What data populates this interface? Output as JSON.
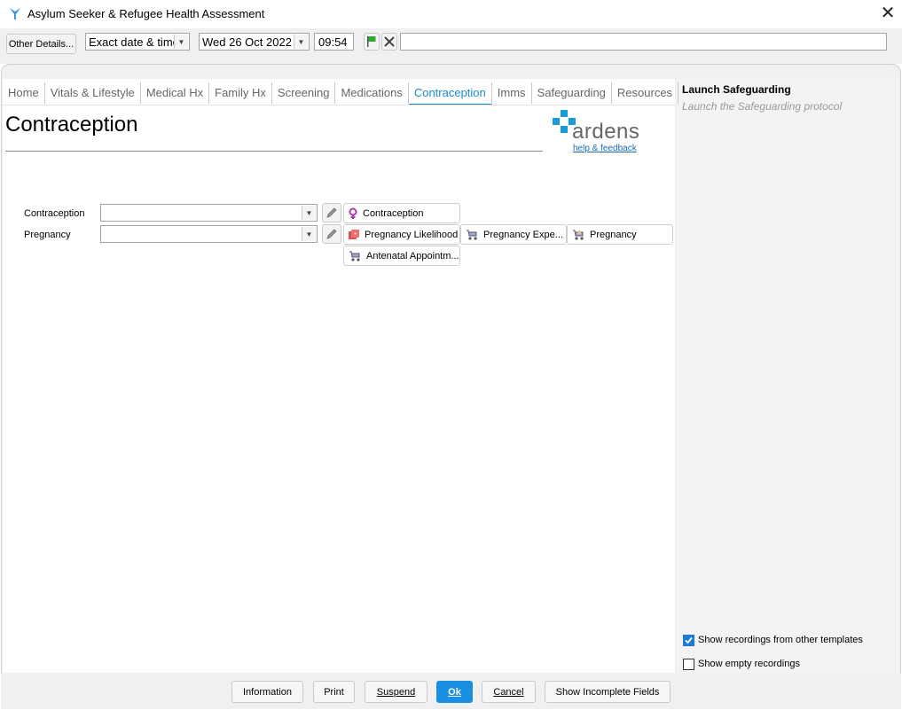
{
  "window": {
    "title": "Asylum Seeker & Refugee Health Assessment"
  },
  "toolbar": {
    "other_details_label": "Other Details...",
    "date_mode": "Exact date & time",
    "date_value": "Wed 26 Oct 2022",
    "time_value": "09:54",
    "free_text_value": ""
  },
  "tabs": [
    {
      "label": "Home"
    },
    {
      "label": "Vitals & Lifestyle"
    },
    {
      "label": "Medical Hx"
    },
    {
      "label": "Family Hx"
    },
    {
      "label": "Screening"
    },
    {
      "label": "Medications"
    },
    {
      "label": "Contraception",
      "active": true
    },
    {
      "label": "Imms"
    },
    {
      "label": "Safeguarding"
    },
    {
      "label": "Resources"
    }
  ],
  "page": {
    "title": "Contraception"
  },
  "logo": {
    "text": "ardens",
    "help_link": "help & feedback"
  },
  "form": {
    "rows": [
      {
        "label": "Contraception",
        "value": ""
      },
      {
        "label": "Pregnancy",
        "value": ""
      }
    ],
    "chips": {
      "contraception": "Contraception",
      "pregnancy_likelihood": "Pregnancy Likelihood",
      "pregnancy_expected": "Pregnancy Expe...",
      "pregnancy": "Pregnancy",
      "antenatal": "Antenatal Appointm..."
    }
  },
  "side_panel": {
    "heading": "Launch Safeguarding",
    "subtext": "Launch the Safeguarding protocol",
    "options": [
      {
        "label": "Show recordings from other templates",
        "checked": true
      },
      {
        "label": "Show empty recordings",
        "checked": false
      }
    ]
  },
  "footer": {
    "information": "Information",
    "print": "Print",
    "suspend": "Suspend",
    "ok": "Ok",
    "cancel": "Cancel",
    "show_incomplete": "Show Incomplete Fields"
  },
  "colors": {
    "accent": "#1a8bc9",
    "primary_button": "#1a8ee0",
    "flag": "#2eaa2e",
    "female_symbol": "#b03ab0"
  }
}
